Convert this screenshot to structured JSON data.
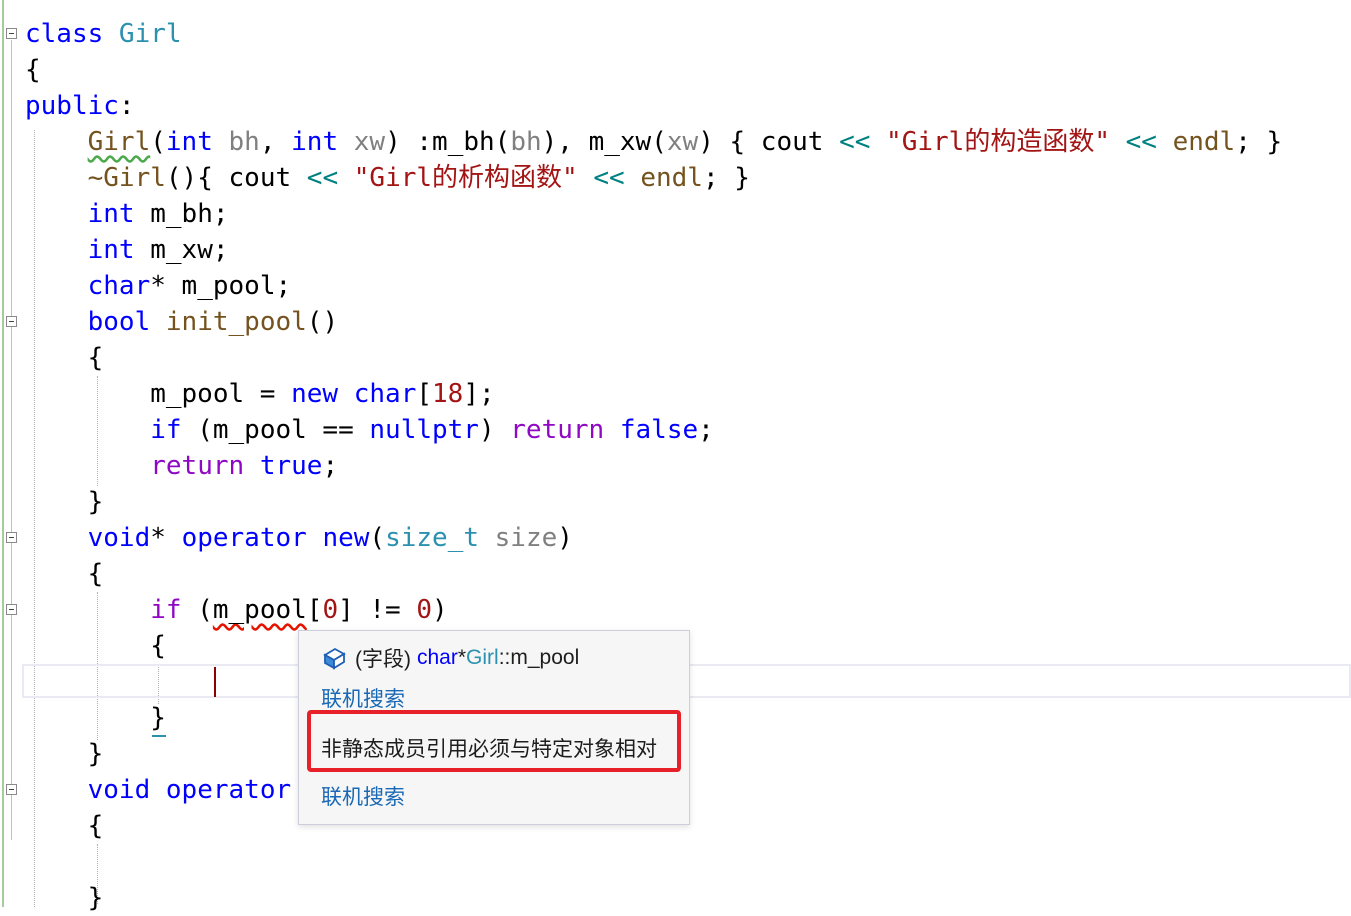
{
  "editor": {
    "lines": [
      {
        "id": "l1",
        "parts": [
          {
            "t": "class ",
            "c": "kw"
          },
          {
            "t": "Girl",
            "c": "type"
          }
        ]
      },
      {
        "id": "l2",
        "parts": [
          {
            "t": "{",
            "c": ""
          }
        ]
      },
      {
        "id": "l3",
        "parts": [
          {
            "t": "public",
            "c": "kw"
          },
          {
            "t": ":",
            "c": ""
          }
        ]
      },
      {
        "id": "l4",
        "parts": [
          {
            "t": "    ",
            "c": ""
          },
          {
            "t": "Girl",
            "c": "fn squig-green"
          },
          {
            "t": "(",
            "c": ""
          },
          {
            "t": "int",
            "c": "kw"
          },
          {
            "t": " ",
            "c": ""
          },
          {
            "t": "bh",
            "c": "param"
          },
          {
            "t": ", ",
            "c": ""
          },
          {
            "t": "int",
            "c": "kw"
          },
          {
            "t": " ",
            "c": ""
          },
          {
            "t": "xw",
            "c": "param"
          },
          {
            "t": ") :m_bh(",
            "c": ""
          },
          {
            "t": "bh",
            "c": "param"
          },
          {
            "t": "), m_xw(",
            "c": ""
          },
          {
            "t": "xw",
            "c": "param"
          },
          {
            "t": ") { cout ",
            "c": ""
          },
          {
            "t": "<<",
            "c": "op"
          },
          {
            "t": " ",
            "c": ""
          },
          {
            "t": "\"Girl的构造函数\"",
            "c": "str"
          },
          {
            "t": " ",
            "c": ""
          },
          {
            "t": "<<",
            "c": "op"
          },
          {
            "t": " ",
            "c": ""
          },
          {
            "t": "endl",
            "c": "fn"
          },
          {
            "t": "; }",
            "c": ""
          }
        ]
      },
      {
        "id": "l5",
        "parts": [
          {
            "t": "    ",
            "c": ""
          },
          {
            "t": "~Girl",
            "c": "fn"
          },
          {
            "t": "(){ cout ",
            "c": ""
          },
          {
            "t": "<<",
            "c": "op"
          },
          {
            "t": " ",
            "c": ""
          },
          {
            "t": "\"Girl的析构函数\"",
            "c": "str"
          },
          {
            "t": " ",
            "c": ""
          },
          {
            "t": "<<",
            "c": "op"
          },
          {
            "t": " ",
            "c": ""
          },
          {
            "t": "endl",
            "c": "fn"
          },
          {
            "t": "; }",
            "c": ""
          }
        ]
      },
      {
        "id": "l6",
        "parts": [
          {
            "t": "    ",
            "c": ""
          },
          {
            "t": "int",
            "c": "kw"
          },
          {
            "t": " m_bh;",
            "c": ""
          }
        ]
      },
      {
        "id": "l7",
        "parts": [
          {
            "t": "    ",
            "c": ""
          },
          {
            "t": "int",
            "c": "kw"
          },
          {
            "t": " m_xw;",
            "c": ""
          }
        ]
      },
      {
        "id": "l8",
        "parts": [
          {
            "t": "    ",
            "c": ""
          },
          {
            "t": "char",
            "c": "kw"
          },
          {
            "t": "* m_pool;",
            "c": ""
          }
        ]
      },
      {
        "id": "l9",
        "parts": [
          {
            "t": "    ",
            "c": ""
          },
          {
            "t": "bool",
            "c": "kw"
          },
          {
            "t": " ",
            "c": ""
          },
          {
            "t": "init_pool",
            "c": "fn"
          },
          {
            "t": "()",
            "c": ""
          }
        ]
      },
      {
        "id": "l10",
        "parts": [
          {
            "t": "    {",
            "c": ""
          }
        ]
      },
      {
        "id": "l11",
        "parts": [
          {
            "t": "        m_pool = ",
            "c": ""
          },
          {
            "t": "new",
            "c": "kw"
          },
          {
            "t": " ",
            "c": ""
          },
          {
            "t": "char",
            "c": "kw"
          },
          {
            "t": "[",
            "c": ""
          },
          {
            "t": "18",
            "c": "str"
          },
          {
            "t": "];",
            "c": ""
          }
        ]
      },
      {
        "id": "l12",
        "parts": [
          {
            "t": "        ",
            "c": ""
          },
          {
            "t": "if",
            "c": "kw"
          },
          {
            "t": " (m_pool == ",
            "c": ""
          },
          {
            "t": "nullptr",
            "c": "kw"
          },
          {
            "t": ") ",
            "c": ""
          },
          {
            "t": "return",
            "c": "kw2"
          },
          {
            "t": " ",
            "c": ""
          },
          {
            "t": "false",
            "c": "kw"
          },
          {
            "t": ";",
            "c": ""
          }
        ]
      },
      {
        "id": "l13",
        "parts": [
          {
            "t": "        ",
            "c": ""
          },
          {
            "t": "return",
            "c": "kw2"
          },
          {
            "t": " ",
            "c": ""
          },
          {
            "t": "true",
            "c": "kw"
          },
          {
            "t": ";",
            "c": ""
          }
        ]
      },
      {
        "id": "l14",
        "parts": [
          {
            "t": "    }",
            "c": ""
          }
        ]
      },
      {
        "id": "l15",
        "parts": [
          {
            "t": "    ",
            "c": ""
          },
          {
            "t": "void",
            "c": "kw"
          },
          {
            "t": "* ",
            "c": ""
          },
          {
            "t": "operator",
            "c": "kw"
          },
          {
            "t": " ",
            "c": ""
          },
          {
            "t": "new",
            "c": "kw"
          },
          {
            "t": "(",
            "c": ""
          },
          {
            "t": "size_t",
            "c": "type"
          },
          {
            "t": " ",
            "c": ""
          },
          {
            "t": "size",
            "c": "param"
          },
          {
            "t": ")",
            "c": ""
          }
        ]
      },
      {
        "id": "l16",
        "parts": [
          {
            "t": "    {",
            "c": ""
          }
        ]
      },
      {
        "id": "l17",
        "parts": [
          {
            "t": "        ",
            "c": ""
          },
          {
            "t": "if",
            "c": "kw2"
          },
          {
            "t": " (",
            "c": ""
          },
          {
            "t": "m_pool",
            "c": "squig-red"
          },
          {
            "t": "[",
            "c": ""
          },
          {
            "t": "0",
            "c": "str"
          },
          {
            "t": "] != ",
            "c": ""
          },
          {
            "t": "0",
            "c": "str"
          },
          {
            "t": ")",
            "c": ""
          }
        ]
      },
      {
        "id": "l18",
        "parts": [
          {
            "t": "        {",
            "c": ""
          }
        ]
      },
      {
        "id": "l19",
        "parts": [
          {
            "t": "",
            "c": ""
          }
        ]
      },
      {
        "id": "l20",
        "parts": [
          {
            "t": "        }",
            "c": ""
          }
        ]
      },
      {
        "id": "l21",
        "parts": [
          {
            "t": "    }",
            "c": ""
          }
        ]
      },
      {
        "id": "l22",
        "parts": [
          {
            "t": "    ",
            "c": ""
          },
          {
            "t": "void",
            "c": "kw"
          },
          {
            "t": " ",
            "c": ""
          },
          {
            "t": "operator",
            "c": "kw"
          }
        ]
      },
      {
        "id": "l23",
        "parts": [
          {
            "t": "    {",
            "c": ""
          }
        ]
      },
      {
        "id": "l24",
        "parts": [
          {
            "t": "",
            "c": ""
          }
        ]
      },
      {
        "id": "l25",
        "parts": [
          {
            "t": "    }",
            "c": ""
          }
        ]
      }
    ]
  },
  "tooltip": {
    "kind": "(字段)",
    "type_kw": "char",
    "ptr": " *",
    "class_name": "Girl",
    "member": "::m_pool",
    "search_link_1": "联机搜索",
    "error_message": "非静态成员引用必须与特定对象相对",
    "search_link_2": "联机搜索",
    "icon": "field-icon"
  }
}
